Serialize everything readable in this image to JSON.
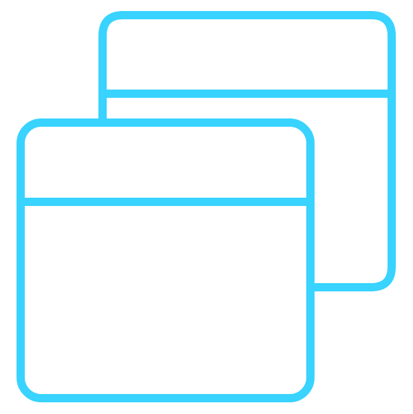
{
  "icon": {
    "name": "multiple-windows-icon",
    "stroke_color": "#38d3ff",
    "background_color": "#ffffff"
  }
}
